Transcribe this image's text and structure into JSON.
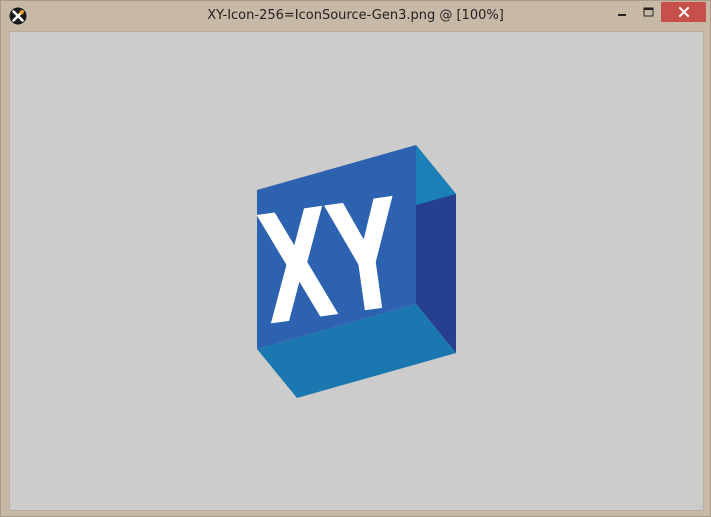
{
  "window": {
    "title": "XY-Icon-256=IconSource-Gen3.png @ [100%]"
  },
  "controls": {
    "minimize_icon": "minimize-icon",
    "maximize_icon": "maximize-icon",
    "close_icon": "close-icon"
  },
  "image": {
    "logo_text": "XY"
  },
  "colors": {
    "titlebar": "#c8b9a7",
    "close_button": "#c7504b",
    "canvas_bg": "#cccccc",
    "cube_front": "#2d62b0",
    "cube_bottom": "#1a77b0",
    "cube_right": "#263f8f",
    "cube_top_right": "#1b7fb8"
  }
}
